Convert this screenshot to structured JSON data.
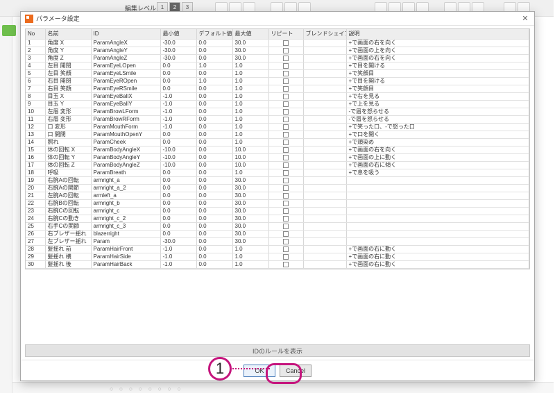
{
  "toolbar": {
    "edit_level_label": "編集レベル：",
    "levels": [
      "1",
      "2",
      "3"
    ],
    "active_level_index": 1
  },
  "dialog": {
    "title": "パラメータ設定",
    "columns": {
      "no": "No",
      "name": "名前",
      "id": "ID",
      "min": "最小値",
      "def": "デフォルト値",
      "max": "最大値",
      "repeat": "リピート",
      "blend": "ブレンドシェイプ",
      "desc": "説明"
    },
    "rows": [
      {
        "no": "1",
        "name": "角度 X",
        "id": "ParamAngleX",
        "min": "-30.0",
        "def": "0.0",
        "max": "30.0",
        "desc": "+で画面の右を向く"
      },
      {
        "no": "2",
        "name": "角度 Y",
        "id": "ParamAngleY",
        "min": "-30.0",
        "def": "0.0",
        "max": "30.0",
        "desc": "+で画面の上を向く"
      },
      {
        "no": "3",
        "name": "角度 Z",
        "id": "ParamAngleZ",
        "min": "-30.0",
        "def": "0.0",
        "max": "30.0",
        "desc": "+で画面の右を向く"
      },
      {
        "no": "4",
        "name": "左目 開閉",
        "id": "ParamEyeLOpen",
        "min": "0.0",
        "def": "1.0",
        "max": "1.0",
        "desc": "+で目を開ける"
      },
      {
        "no": "5",
        "name": "左目 笑顔",
        "id": "ParamEyeLSmile",
        "min": "0.0",
        "def": "0.0",
        "max": "1.0",
        "desc": "+で笑顔目"
      },
      {
        "no": "6",
        "name": "右目 開閉",
        "id": "ParamEyeROpen",
        "min": "0.0",
        "def": "1.0",
        "max": "1.0",
        "desc": "+で目を開ける"
      },
      {
        "no": "7",
        "name": "右目 笑顔",
        "id": "ParamEyeRSmile",
        "min": "0.0",
        "def": "0.0",
        "max": "1.0",
        "desc": "+で笑顔目"
      },
      {
        "no": "8",
        "name": "目玉 X",
        "id": "ParamEyeBallX",
        "min": "-1.0",
        "def": "0.0",
        "max": "1.0",
        "desc": "+で右を見る"
      },
      {
        "no": "9",
        "name": "目玉 Y",
        "id": "ParamEyeBallY",
        "min": "-1.0",
        "def": "0.0",
        "max": "1.0",
        "desc": "+で上を見る"
      },
      {
        "no": "10",
        "name": "左眉 変形",
        "id": "ParamBrowLForm",
        "min": "-1.0",
        "def": "0.0",
        "max": "1.0",
        "desc": "-で眉を怒らせる"
      },
      {
        "no": "11",
        "name": "右眉 変形",
        "id": "ParamBrowRForm",
        "min": "-1.0",
        "def": "0.0",
        "max": "1.0",
        "desc": "-で眉を怒らせる"
      },
      {
        "no": "12",
        "name": "口 変形",
        "id": "ParamMouthForm",
        "min": "-1.0",
        "def": "0.0",
        "max": "1.0",
        "desc": "+で笑った口、-で怒った口"
      },
      {
        "no": "13",
        "name": "口 開閉",
        "id": "ParamMouthOpenY",
        "min": "0.0",
        "def": "0.0",
        "max": "1.0",
        "desc": "+で口を開く"
      },
      {
        "no": "14",
        "name": "照れ",
        "id": "ParamCheek",
        "min": "0.0",
        "def": "0.0",
        "max": "1.0",
        "desc": "+で頬染め"
      },
      {
        "no": "15",
        "name": "体の回転 X",
        "id": "ParamBodyAngleX",
        "min": "-10.0",
        "def": "0.0",
        "max": "10.0",
        "desc": "+で画面の右を向く"
      },
      {
        "no": "16",
        "name": "体の回転 Y",
        "id": "ParamBodyAngleY",
        "min": "-10.0",
        "def": "0.0",
        "max": "10.0",
        "desc": "+で画面の上に動く"
      },
      {
        "no": "17",
        "name": "体の回転 Z",
        "id": "ParamBodyAngleZ",
        "min": "-10.0",
        "def": "0.0",
        "max": "10.0",
        "desc": "+で画面の右に傾く"
      },
      {
        "no": "18",
        "name": "呼吸",
        "id": "ParamBreath",
        "min": "0.0",
        "def": "0.0",
        "max": "1.0",
        "desc": "+で息を吸う"
      },
      {
        "no": "19",
        "name": "右腕Aの回転",
        "id": "armright_a",
        "min": "0.0",
        "def": "0.0",
        "max": "30.0",
        "desc": ""
      },
      {
        "no": "20",
        "name": "右腕Aの関節",
        "id": "armright_a_2",
        "min": "0.0",
        "def": "0.0",
        "max": "30.0",
        "desc": ""
      },
      {
        "no": "21",
        "name": "左腕Aの回転",
        "id": "armleft_a",
        "min": "0.0",
        "def": "0.0",
        "max": "30.0",
        "desc": ""
      },
      {
        "no": "22",
        "name": "右腕Bの回転",
        "id": "armright_b",
        "min": "0.0",
        "def": "0.0",
        "max": "30.0",
        "desc": ""
      },
      {
        "no": "23",
        "name": "右腕Cの回転",
        "id": "armright_c",
        "min": "0.0",
        "def": "0.0",
        "max": "30.0",
        "desc": ""
      },
      {
        "no": "24",
        "name": "右腕Cの動き",
        "id": "armright_c_2",
        "min": "0.0",
        "def": "0.0",
        "max": "30.0",
        "desc": ""
      },
      {
        "no": "25",
        "name": "右手Cの関節",
        "id": "armright_c_3",
        "min": "0.0",
        "def": "0.0",
        "max": "30.0",
        "desc": ""
      },
      {
        "no": "26",
        "name": "右ブレザー揺れ",
        "id": "blazerright",
        "min": "0.0",
        "def": "0.0",
        "max": "30.0",
        "desc": ""
      },
      {
        "no": "27",
        "name": "左ブレザー揺れ",
        "id": "Param",
        "min": "-30.0",
        "def": "0.0",
        "max": "30.0",
        "desc": ""
      },
      {
        "no": "28",
        "name": "髪揺れ 前",
        "id": "ParamHairFront",
        "min": "-1.0",
        "def": "0.0",
        "max": "1.0",
        "desc": "+で画面の右に動く"
      },
      {
        "no": "29",
        "name": "髪揺れ 横",
        "id": "ParamHairSide",
        "min": "-1.0",
        "def": "0.0",
        "max": "1.0",
        "desc": "+で画面の右に動く"
      },
      {
        "no": "30",
        "name": "髪揺れ 後",
        "id": "ParamHairBack",
        "min": "-1.0",
        "def": "0.0",
        "max": "1.0",
        "desc": "+で画面の右に動く"
      }
    ],
    "rule_button": "IDのルールを表示",
    "ok": "OK",
    "cancel": "Cancel"
  },
  "callout": {
    "number": "1"
  }
}
